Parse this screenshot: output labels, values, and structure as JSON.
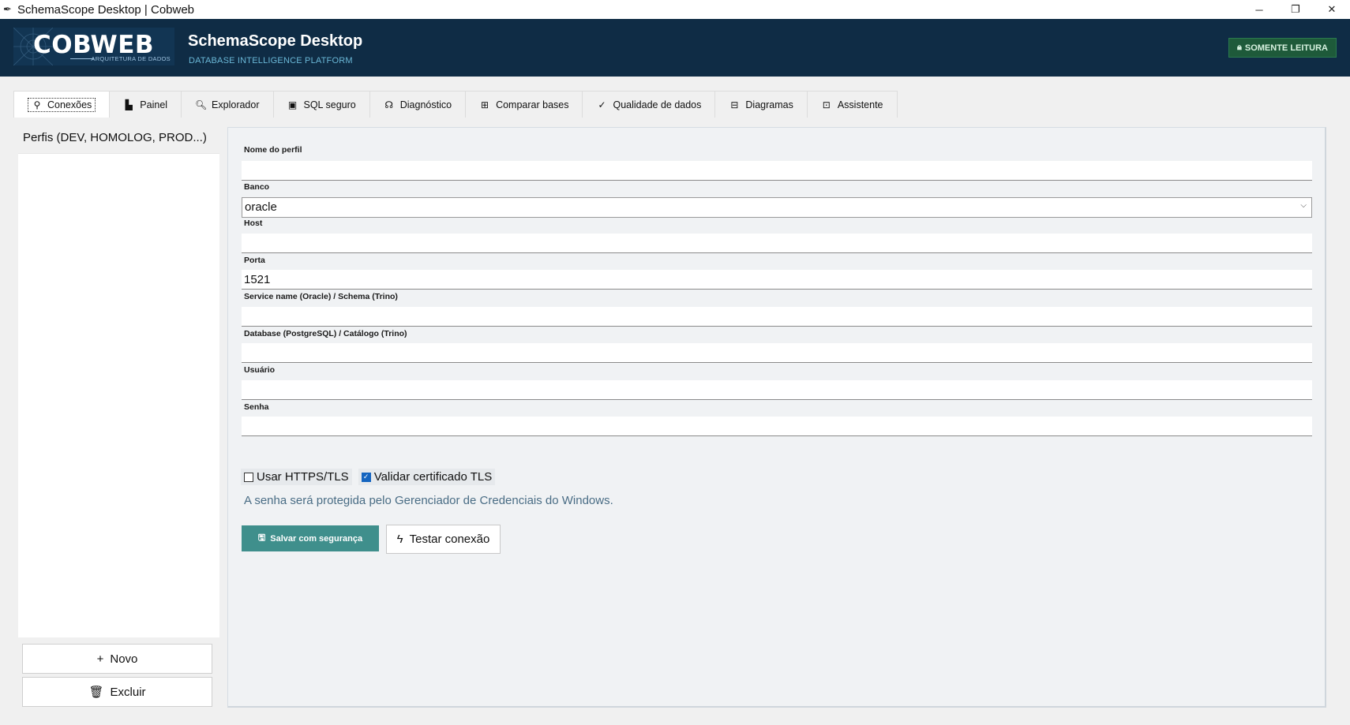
{
  "window": {
    "title": "SchemaScope Desktop | Cobweb",
    "minimize": "─",
    "maximize": "❐",
    "close": "✕"
  },
  "header": {
    "logo_text": "COBWEB",
    "logo_subtitle": "ARQUITETURA DE DADOS",
    "app_title": "SchemaScope Desktop",
    "app_subtitle": "DATABASE INTELLIGENCE PLATFORM",
    "readonly_badge": "SOMENTE LEITURA"
  },
  "tabs": [
    {
      "label": "Conexões",
      "icon": "plug-icon",
      "active": true
    },
    {
      "label": "Painel",
      "icon": "dashboard-icon",
      "active": false
    },
    {
      "label": "Explorador",
      "icon": "magnifier-icon",
      "active": false
    },
    {
      "label": "SQL seguro",
      "icon": "monitor-icon",
      "active": false
    },
    {
      "label": "Diagnóstico",
      "icon": "stethoscope-icon",
      "active": false
    },
    {
      "label": "Comparar bases",
      "icon": "compare-icon",
      "active": false
    },
    {
      "label": "Qualidade de dados",
      "icon": "check-icon",
      "active": false
    },
    {
      "label": "Diagramas",
      "icon": "diagram-icon",
      "active": false
    },
    {
      "label": "Assistente",
      "icon": "robot-icon",
      "active": false
    }
  ],
  "sidebar": {
    "heading": "Perfis (DEV, HOMOLOG, PROD...)",
    "new_button": "Novo",
    "delete_button": "Excluir"
  },
  "form": {
    "profile_name": {
      "label": "Nome do perfil",
      "value": ""
    },
    "database": {
      "label": "Banco",
      "value": "oracle"
    },
    "host": {
      "label": "Host",
      "value": ""
    },
    "port": {
      "label": "Porta",
      "value": "1521"
    },
    "service_name": {
      "label": "Service name (Oracle) / Schema (Trino)",
      "value": ""
    },
    "database_name": {
      "label": "Database (PostgreSQL) / Catálogo (Trino)",
      "value": ""
    },
    "user": {
      "label": "Usuário",
      "value": ""
    },
    "password": {
      "label": "Senha",
      "value": ""
    },
    "use_https": {
      "label": "Usar HTTPS/TLS",
      "checked": false
    },
    "validate_tls": {
      "label": "Validar certificado TLS",
      "checked": true
    },
    "hint": "A senha será protegida pelo Gerenciador de Credenciais do Windows.",
    "save_button": "Salvar com segurança",
    "test_button": "Testar conexão"
  },
  "colors": {
    "header_bg": "#0f2c45",
    "accent_teal": "#3f8f8c",
    "badge_green": "#1e5a3a",
    "checkbox_blue": "#1565c0"
  }
}
